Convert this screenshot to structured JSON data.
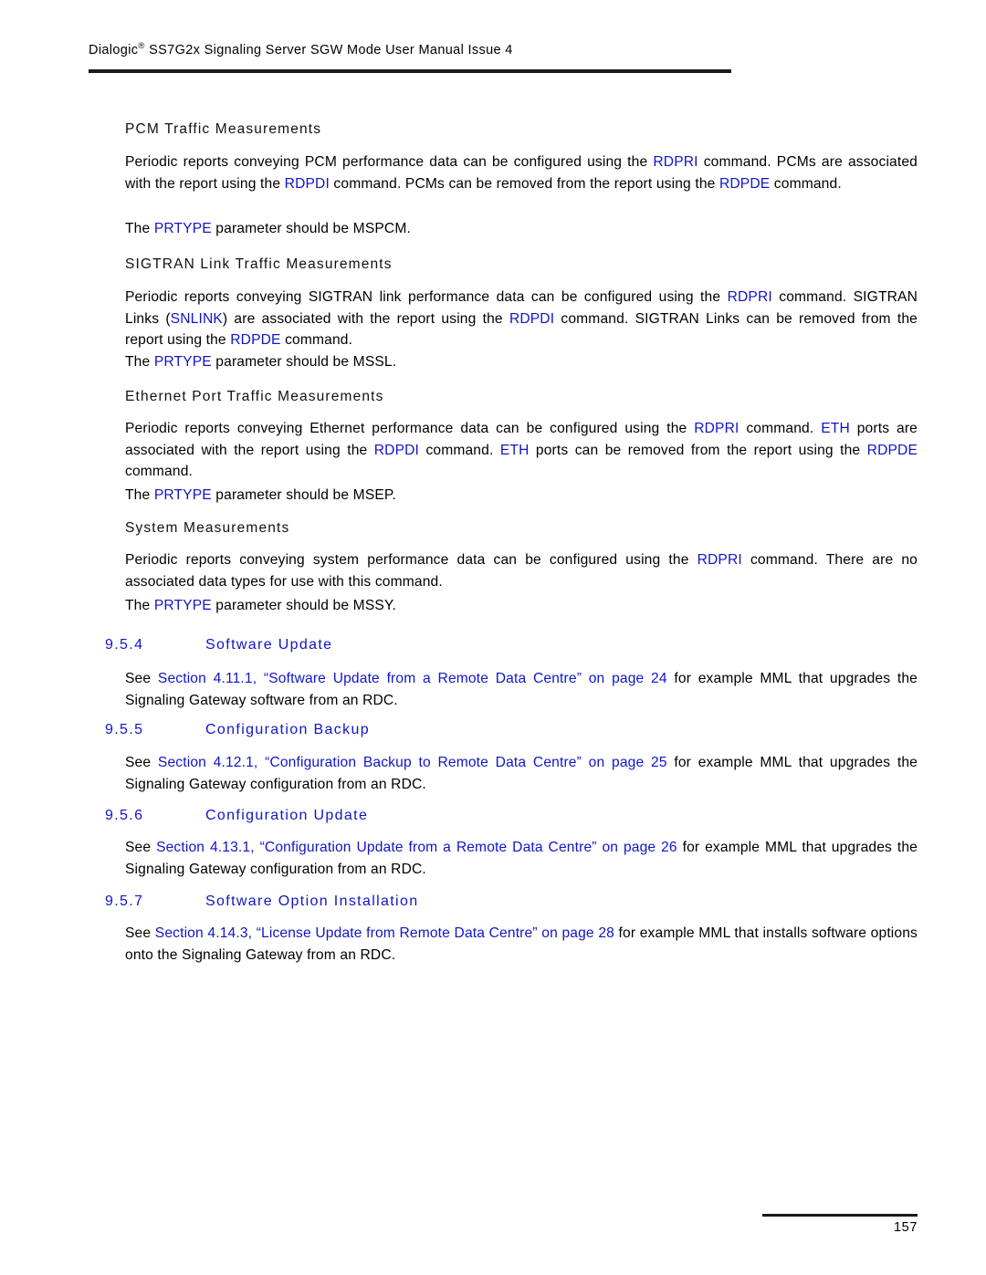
{
  "header": {
    "brand": "Dialogic",
    "registered_mark": "®",
    "title_rest": " SS7G2x Signaling Server SGW Mode User Manual  Issue 4"
  },
  "colors": {
    "link_blue": "#1015c8",
    "body_black": "#000000",
    "rule": "#1a1a1a"
  },
  "sections": {
    "pcm": {
      "heading": "PCM Traffic Measurements",
      "para_1": {
        "t1": "Periodic reports conveying PCM performance data can be configured using the ",
        "c1": "RDPRI",
        "t2": " command. PCMs are associated with the report using the ",
        "c2": "RDPDI",
        "t3": " command. PCMs can be removed from the report using the ",
        "c3": "RDPDE",
        "t4": " command."
      },
      "para_2": {
        "t1": "The ",
        "c1": "PRTYPE",
        "t2": " parameter should be MSPCM."
      }
    },
    "sigtran": {
      "heading": "SIGTRAN Link Traffic Measurements",
      "para_1": {
        "t1": "Periodic reports conveying SIGTRAN link performance data can be configured using the ",
        "c1": "RDPRI",
        "t2": " command. SIGTRAN Links (",
        "c2": "SNLINK",
        "t3": ") are associated with the report using the ",
        "c3": "RDPDI",
        "t4": " command. SIGTRAN Links can be removed from the report using the ",
        "c4": "RDPDE",
        "t5": " command."
      },
      "para_2": {
        "t1": "The ",
        "c1": "PRTYPE",
        "t2": " parameter should be MSSL."
      }
    },
    "ethernet": {
      "heading": "Ethernet Port Traffic Measurements",
      "para_1": {
        "t1": "Periodic reports conveying Ethernet performance data can be configured using the ",
        "c1": "RDPRI",
        "t2": " command. ",
        "c2": "ETH",
        "t3": " ports are associated with the report using the ",
        "c3": "RDPDI",
        "t4": " command. ",
        "c4": "ETH",
        "t5": " ports can be removed from the report using the ",
        "c5": "RDPDE",
        "t6": " command."
      },
      "para_2": {
        "t1": "The ",
        "c1": "PRTYPE",
        "t2": " parameter should be MSEP."
      }
    },
    "system": {
      "heading": "System Measurements",
      "para_1": {
        "t1": "Periodic reports conveying system performance data can be configured using the ",
        "c1": "RDPRI",
        "t2": " command. There are no associated data types for use with this command."
      },
      "para_2": {
        "t1": "The ",
        "c1": "PRTYPE",
        "t2": " parameter should be MSSY."
      }
    }
  },
  "numbered": [
    {
      "number": "9.5.4",
      "title": "Software Update",
      "body": {
        "t1": "See ",
        "link": "Section 4.11.1, “Software Update from a Remote Data Centre” on page 24",
        "t2": " for example MML that upgrades the Signaling Gateway software from an RDC."
      }
    },
    {
      "number": "9.5.5",
      "title": "Configuration Backup",
      "body": {
        "t1": "See ",
        "link": "Section 4.12.1, “Configuration Backup to Remote Data Centre” on page 25",
        "t2": " for example MML that upgrades the Signaling Gateway configuration from an RDC."
      }
    },
    {
      "number": "9.5.6",
      "title": "Configuration Update",
      "body": {
        "t1": "See ",
        "link": "Section 4.13.1, “Configuration Update from a Remote Data Centre” on page 26",
        "t2": " for example MML that upgrades the Signaling Gateway configuration from an RDC."
      }
    },
    {
      "number": "9.5.7",
      "title": "Software Option Installation",
      "body": {
        "t1": "See ",
        "link": "Section 4.14.3, “License Update from Remote Data Centre” on page 28",
        "t2": " for example MML that installs software options onto the Signaling Gateway from an RDC."
      }
    }
  ],
  "footer": {
    "page_number": "157"
  }
}
